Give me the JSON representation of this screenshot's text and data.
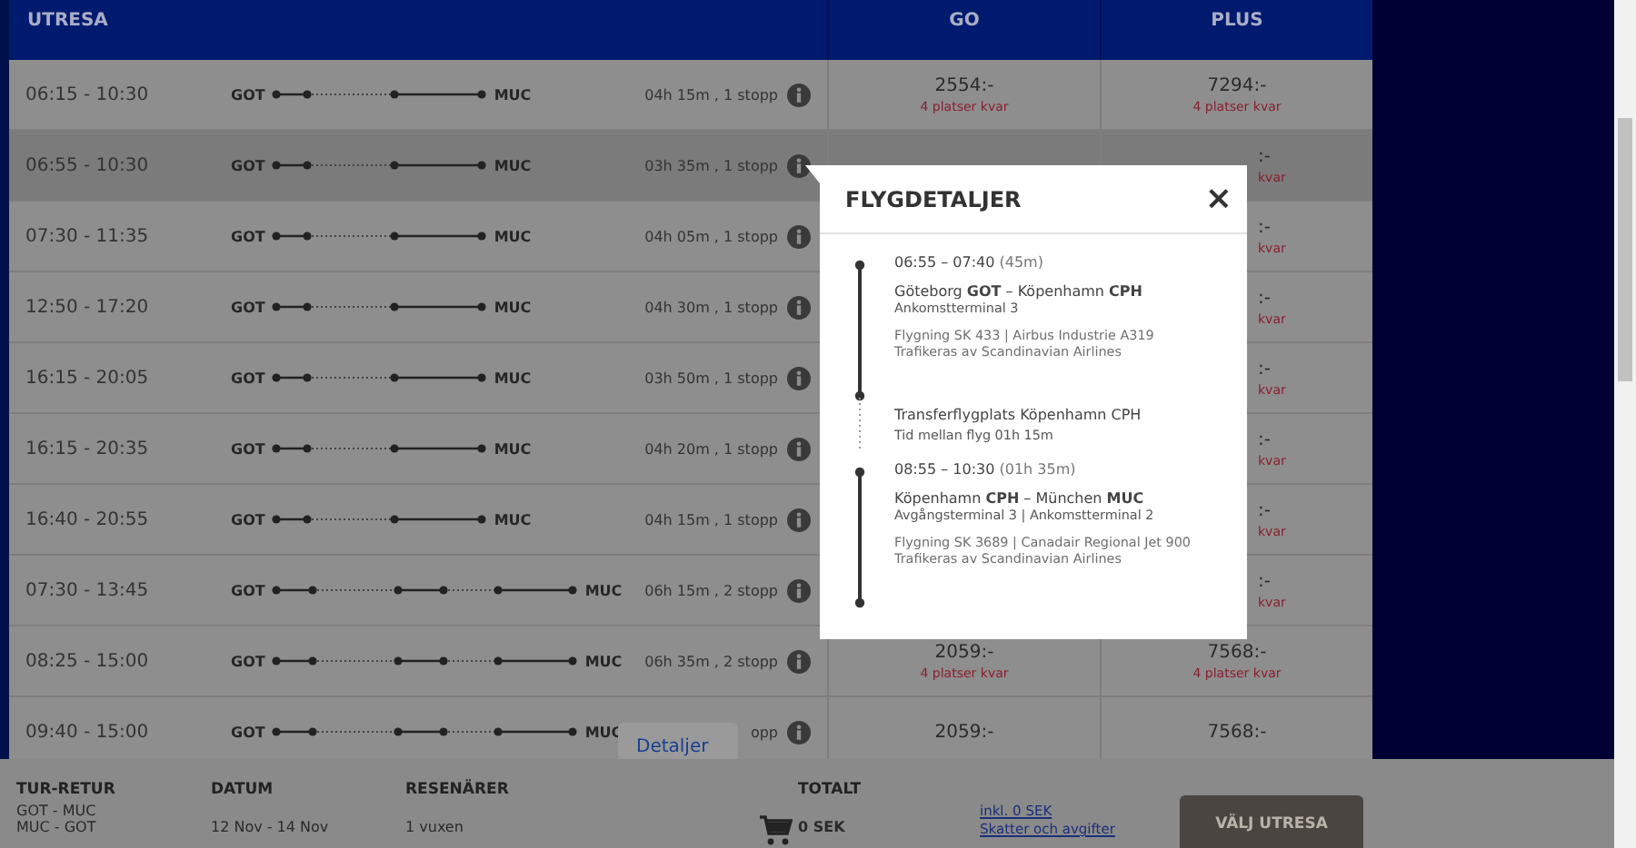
{
  "table": {
    "columns": [
      {
        "label": "UTRESA"
      },
      {
        "label": "GO"
      },
      {
        "label": "PLUS"
      }
    ],
    "rows": [
      {
        "times": "06:15 - 10:30",
        "from": "GOT",
        "to": "MUC",
        "kind": "one-stop",
        "duration": "04h 15m , 1 stopp",
        "selected": false,
        "go_price": "2554:-",
        "go_seats": "4 platser kvar",
        "plus_price": "7294:-",
        "plus_seats": "4 platser kvar",
        "covered": false
      },
      {
        "times": "06:55 - 10:30",
        "from": "GOT",
        "to": "MUC",
        "kind": "one-stop",
        "duration": "03h 35m , 1 stopp",
        "selected": true,
        "plus_price": ":-",
        "plus_seats": "kvar",
        "covered": true
      },
      {
        "times": "07:30 - 11:35",
        "from": "GOT",
        "to": "MUC",
        "kind": "one-stop",
        "duration": "04h 05m , 1 stopp",
        "selected": false,
        "plus_price": ":-",
        "plus_seats": "kvar",
        "covered": true
      },
      {
        "times": "12:50 - 17:20",
        "from": "GOT",
        "to": "MUC",
        "kind": "one-stop",
        "duration": "04h 30m , 1 stopp",
        "selected": false,
        "plus_price": ":-",
        "plus_seats": "kvar",
        "covered": true
      },
      {
        "times": "16:15 - 20:05",
        "from": "GOT",
        "to": "MUC",
        "kind": "one-stop",
        "duration": "03h 50m , 1 stopp",
        "selected": false,
        "plus_price": ":-",
        "plus_seats": "kvar",
        "covered": true
      },
      {
        "times": "16:15 - 20:35",
        "from": "GOT",
        "to": "MUC",
        "kind": "one-stop",
        "duration": "04h 20m , 1 stopp",
        "selected": false,
        "plus_price": ":-",
        "plus_seats": "kvar",
        "covered": true
      },
      {
        "times": "16:40 - 20:55",
        "from": "GOT",
        "to": "MUC",
        "kind": "one-stop",
        "duration": "04h 15m , 1 stopp",
        "selected": false,
        "plus_price": ":-",
        "plus_seats": "kvar",
        "covered": true
      },
      {
        "times": "07:30 - 13:45",
        "from": "GOT",
        "to": "MUC",
        "kind": "two-stop",
        "duration": "06h 15m , 2 stopp",
        "selected": false,
        "plus_price": ":-",
        "plus_seats": "kvar",
        "covered": true
      },
      {
        "times": "08:25 - 15:00",
        "from": "GOT",
        "to": "MUC",
        "kind": "two-stop",
        "duration": "06h 35m , 2 stopp",
        "selected": false,
        "go_price": "2059:-",
        "go_seats": "4 platser kvar",
        "plus_price": "7568:-",
        "plus_seats": "4 platser kvar",
        "covered": false
      },
      {
        "times": "09:40 - 15:00",
        "from": "GOT",
        "to": "MUC",
        "kind": "two-stop",
        "duration": "opp",
        "selected": false,
        "go_price": "2059:-",
        "plus_price": "7568:-",
        "covered": false
      }
    ]
  },
  "details_tab": {
    "label": "Detaljer"
  },
  "popup": {
    "title": "FLYGDETALJER",
    "close": "×",
    "legs": [
      {
        "kind": "flight",
        "time": "06:55 – 07:40",
        "duration": "(45m)",
        "route": "Göteborg **GOT** – Köpenhamn **CPH**",
        "terminals": "Ankomstterminal 3",
        "flight": "Flygning SK 433 | Airbus Industrie A319",
        "operator": "Trafikeras av Scandinavian Airlines"
      },
      {
        "kind": "transfer",
        "place": "Transferflygplats Köpenhamn CPH",
        "wait": "Tid mellan flyg 01h 15m"
      },
      {
        "kind": "flight",
        "time": "08:55 – 10:30",
        "duration": "(01h 35m)",
        "route": "Köpenhamn **CPH** – München **MUC**",
        "terminals": "Avgångsterminal 3 |  Ankomstterminal 2",
        "flight": "Flygning SK 3689 | Canadair Regional Jet 900",
        "operator": "Trafikeras av Scandinavian Airlines"
      }
    ]
  },
  "footer": {
    "trip": {
      "label": "TUR-RETUR",
      "lines": [
        "GOT - MUC",
        "MUC - GOT"
      ]
    },
    "date": {
      "label": "DATUM",
      "value": "12 Nov - 14 Nov"
    },
    "travellers": {
      "label": "RESENÄRER",
      "value": "1 vuxen"
    },
    "total": {
      "label": "TOTALT",
      "value": "0 SEK"
    },
    "links": [
      "inkl. 0 SEK",
      "Skatter och avgifter"
    ],
    "button": "VÄLJ UTRESA"
  }
}
